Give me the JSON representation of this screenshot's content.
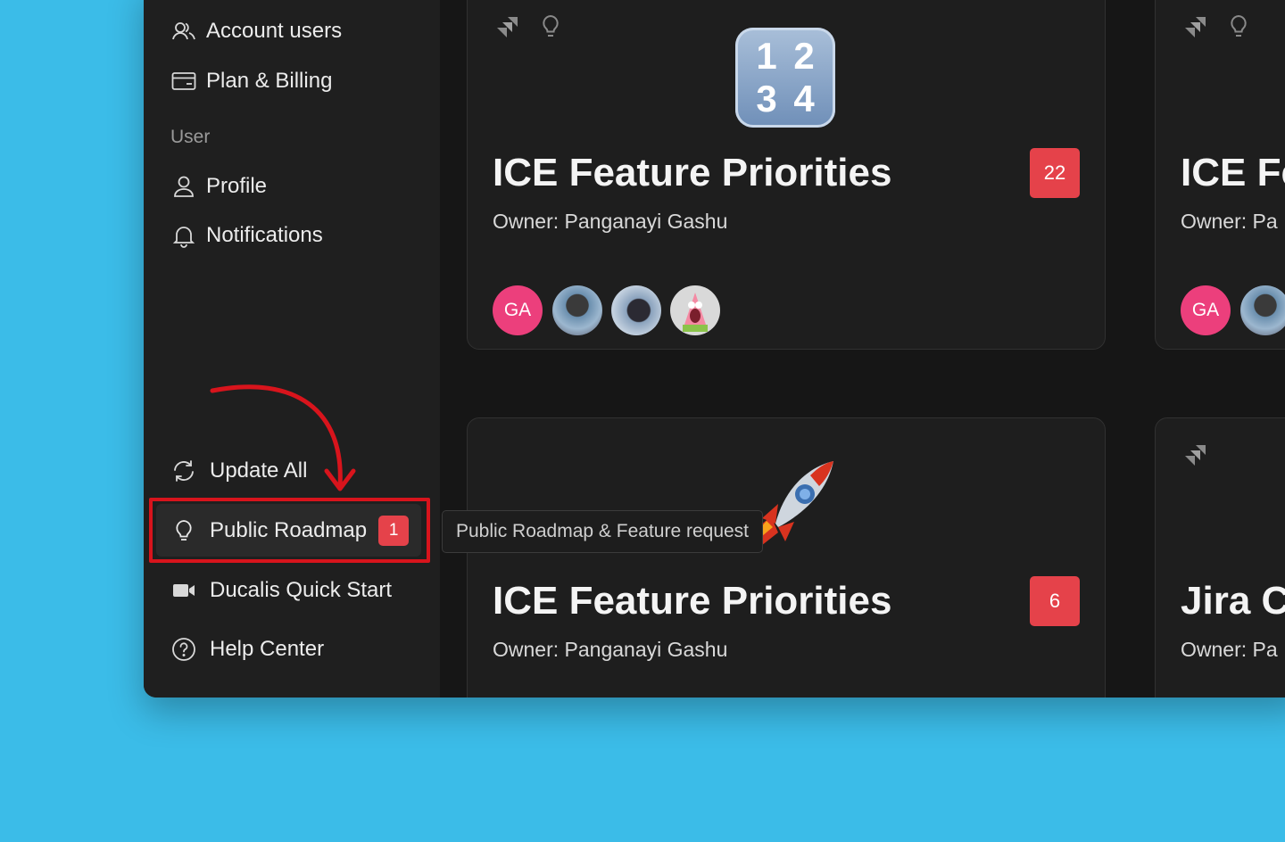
{
  "sidebar": {
    "items_top": [
      {
        "label": "Account users",
        "icon": "users-icon"
      },
      {
        "label": "Plan & Billing",
        "icon": "credit-card-icon"
      }
    ],
    "section_user": "User",
    "items_user": [
      {
        "label": "Profile",
        "icon": "person-icon"
      },
      {
        "label": "Notifications",
        "icon": "bell-icon"
      }
    ],
    "items_bottom": [
      {
        "label": "Update All",
        "icon": "refresh-icon"
      },
      {
        "label": "Public Roadmap",
        "icon": "lightbulb-icon",
        "badge": "1"
      },
      {
        "label": "Ducalis Quick Start",
        "icon": "video-camera-icon"
      },
      {
        "label": "Help Center",
        "icon": "question-circle-icon"
      }
    ]
  },
  "tooltip": "Public Roadmap & Feature request",
  "cards": [
    {
      "title": "ICE Feature Priorities",
      "owner": "Owner: Panganayi Gashu",
      "badge": "22",
      "emoji_numbers": [
        "1",
        "2",
        "3",
        "4"
      ],
      "avatar_initials": "GA"
    },
    {
      "title": "ICE Fe",
      "owner": "Owner: Pa",
      "avatar_initials": "GA"
    },
    {
      "title": "ICE Feature Priorities",
      "owner": "Owner: Panganayi Gashu",
      "badge": "6",
      "emoji": "rocket"
    },
    {
      "title": "Jira C",
      "owner": "Owner: Pa"
    }
  ],
  "colors": {
    "background": "#3bbce8",
    "app_bg": "#161616",
    "sidebar_bg": "#1f1f1f",
    "badge": "#e5424a",
    "annotation": "#d8141c",
    "avatar_pink": "#ec3f7c"
  }
}
